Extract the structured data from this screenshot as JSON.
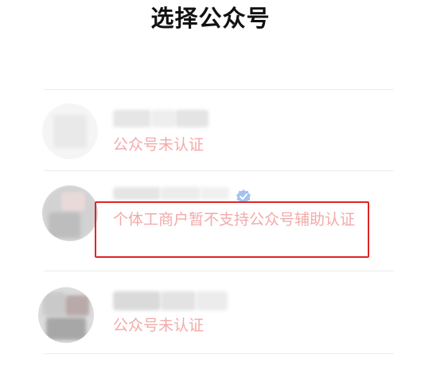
{
  "page": {
    "title": "选择公众号"
  },
  "accounts": [
    {
      "name": "",
      "status": "公众号未认证"
    },
    {
      "name": "",
      "status": "个体工商户暂不支持公众号辅助认证",
      "verified_icon": "verified-badge-icon"
    },
    {
      "name": "",
      "status": "公众号未认证"
    }
  ],
  "colors": {
    "status_text": "#f4a9a9",
    "highlight_border": "#e02424",
    "divider": "#ececec"
  }
}
